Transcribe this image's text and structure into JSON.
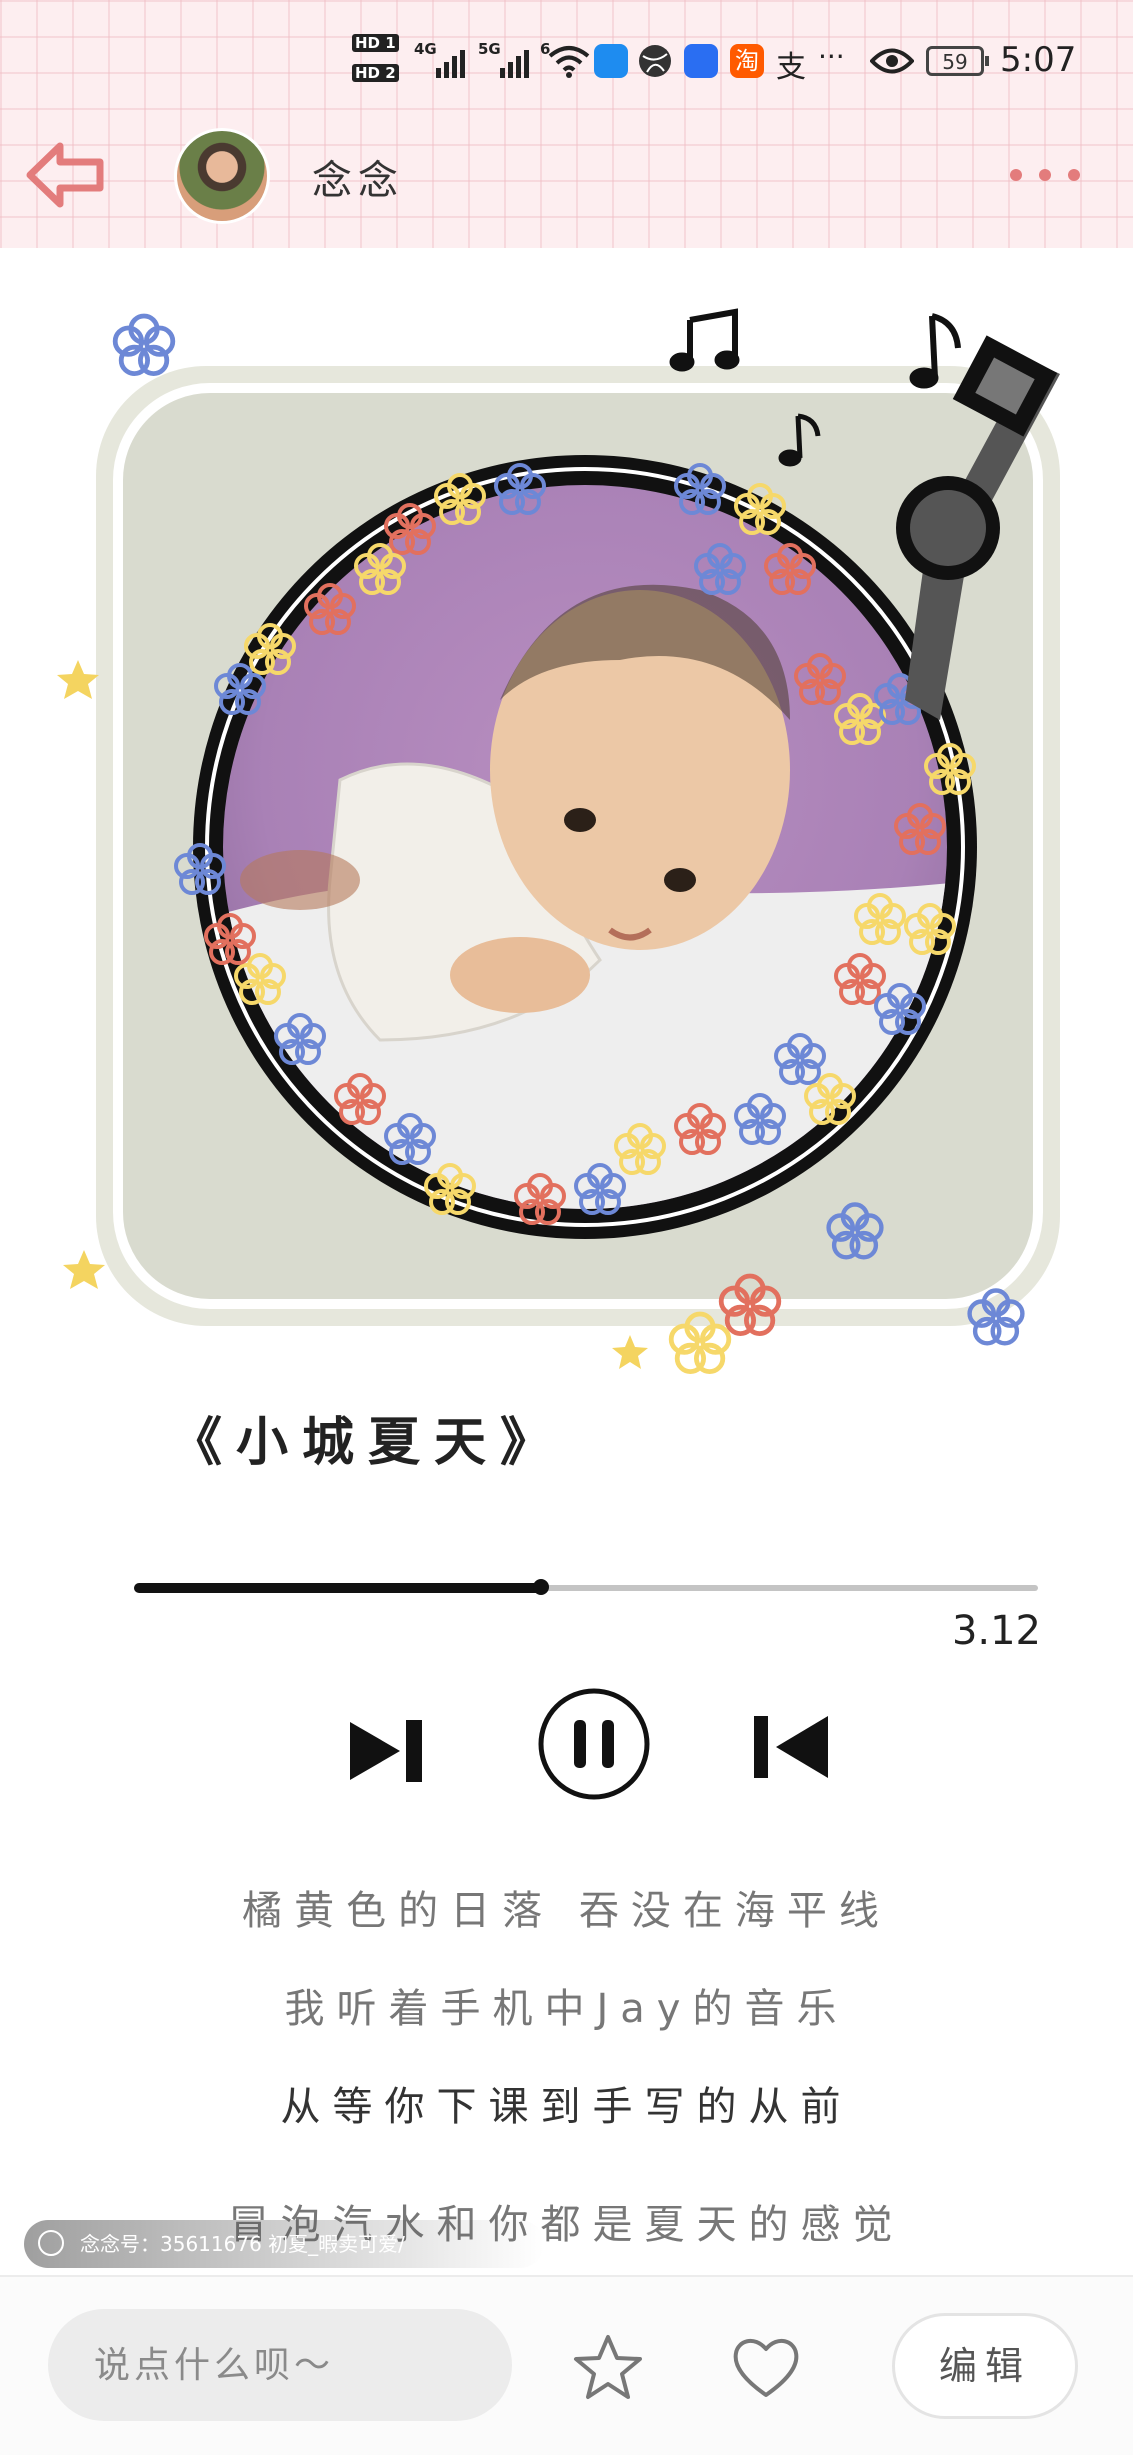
{
  "status_bar": {
    "hd1": "HD 1",
    "hd2": "HD 2",
    "net1": "4G",
    "net2": "5G",
    "wifi_gen": "6",
    "icons": [
      "signal-icon",
      "wifi-icon",
      "search-app-icon",
      "browser-app-icon",
      "bulb-app-icon",
      "taobao-app-icon",
      "alipay-icon",
      "more-dots-icon",
      "eye-icon",
      "battery-icon"
    ],
    "taobao": "淘",
    "alipay": "支",
    "more": "···",
    "battery": "59",
    "time": "5:07"
  },
  "header": {
    "username": "念念",
    "back_icon": "arrow-left-icon",
    "more_icon": "more-icon",
    "accent": "#e37c7c"
  },
  "player": {
    "title": "《小城夏天》",
    "progress": 0.45,
    "time": "3.12",
    "controls": [
      "next-icon",
      "pause-icon",
      "previous-icon"
    ]
  },
  "lyrics": [
    "橘黄色的日落 吞没在海平线",
    "我听着手机中Jay的音乐",
    "从等你下课到手写的从前",
    "冒泡汽水和你都是夏天的感觉"
  ],
  "watermark": {
    "text": "念念号：35611676 初夏_暇卖可爱/"
  },
  "bottom_bar": {
    "comment_placeholder": "说点什么呗～",
    "edit_label": "编辑",
    "star_icon": "star-icon",
    "heart_icon": "heart-icon"
  },
  "colors": {
    "frame": "#dcdcd0",
    "flower_blue": "#6d88d6",
    "flower_yellow": "#f6d86a",
    "flower_red": "#e2705e",
    "header_bg": "#fdeef0"
  }
}
